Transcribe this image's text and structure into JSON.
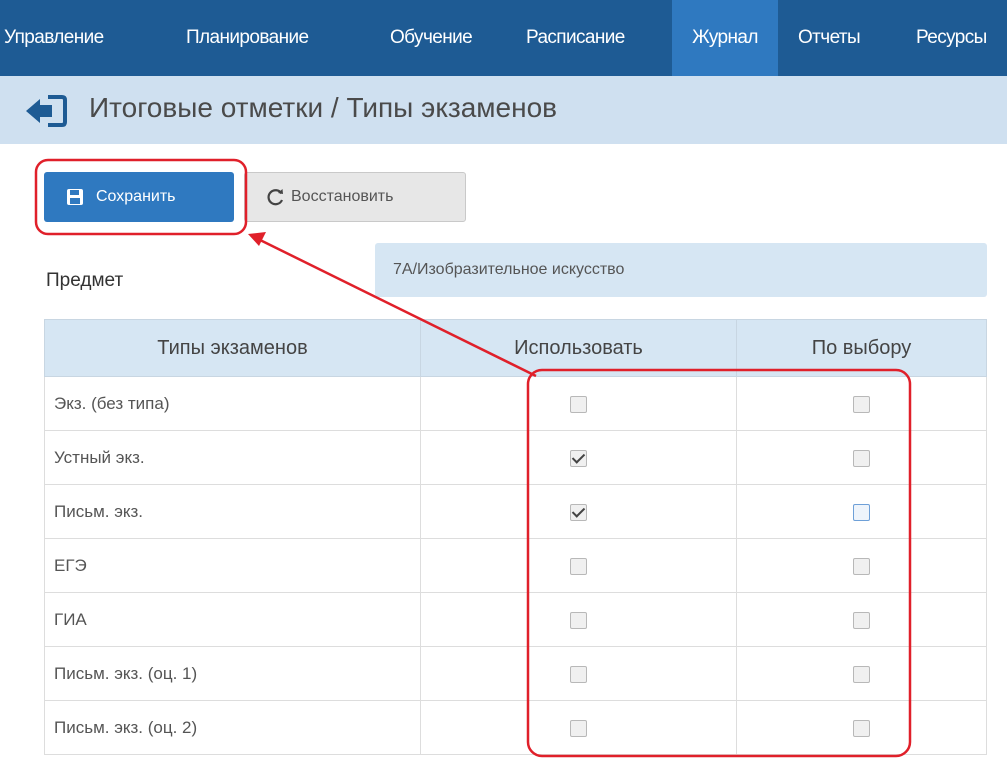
{
  "nav": {
    "items": [
      {
        "label": "Управление",
        "active": false
      },
      {
        "label": "Планирование",
        "active": false
      },
      {
        "label": "Обучение",
        "active": false
      },
      {
        "label": "Расписание",
        "active": false
      },
      {
        "label": "Журнал",
        "active": true
      },
      {
        "label": "Отчеты",
        "active": false
      },
      {
        "label": "Ресурсы",
        "active": false
      }
    ]
  },
  "header": {
    "back_icon": "sign-out-left-icon",
    "title": "Итоговые отметки / Типы экзаменов"
  },
  "toolbar": {
    "save_label": "Сохранить",
    "save_icon": "floppy-disk-icon",
    "restore_label": "Восстановить",
    "restore_icon": "refresh-icon"
  },
  "subject": {
    "label": "Предмет",
    "value": "7А/Изобразительное искусство"
  },
  "table": {
    "columns": [
      "Типы экзаменов",
      "Использовать",
      "По выбору"
    ],
    "rows": [
      {
        "name": "Экз. (без типа)",
        "use": false,
        "optional": false
      },
      {
        "name": "Устный экз.",
        "use": true,
        "optional": false
      },
      {
        "name": "Письм. экз.",
        "use": true,
        "optional": false
      },
      {
        "name": "ЕГЭ",
        "use": false,
        "optional": false
      },
      {
        "name": "ГИА",
        "use": false,
        "optional": false
      },
      {
        "name": "Письм. экз. (оц. 1)",
        "use": false,
        "optional": false
      },
      {
        "name": "Письм. экз. (оц. 2)",
        "use": false,
        "optional": false
      }
    ]
  },
  "colors": {
    "nav_bg": "#1e5b94",
    "nav_active": "#2f79c0",
    "title_bg": "#cfe0f0",
    "annotation": "#e0202a"
  }
}
